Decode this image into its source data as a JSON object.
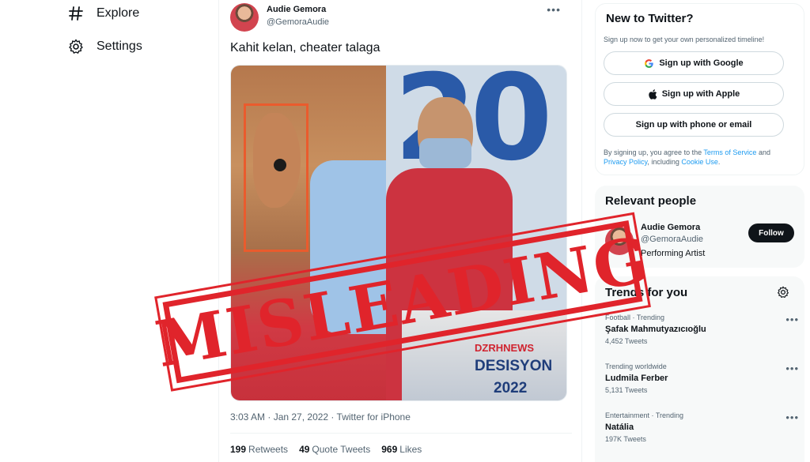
{
  "nav": {
    "items": [
      {
        "label": "Explore",
        "icon": "hashtag-icon"
      },
      {
        "label": "Settings",
        "icon": "gear-icon"
      }
    ]
  },
  "tweet": {
    "author_name": "Audie Gemora",
    "author_handle": "@GemoraAudie",
    "text": "Kahit kelan, cheater talaga",
    "media_text": {
      "station": "DZRHNEWS",
      "program": "DESISYON",
      "year": "2022"
    },
    "timestamp": "3:03 AM · Jan 27, 2022 · Twitter for iPhone",
    "stats": [
      {
        "value": "199",
        "label": "Retweets"
      },
      {
        "value": "49",
        "label": "Quote Tweets"
      },
      {
        "value": "969",
        "label": "Likes"
      }
    ]
  },
  "stamp": {
    "text": "MISLEADING",
    "color": "#e0242b"
  },
  "sidebar": {
    "new_to_twitter": {
      "title": "New to Twitter?",
      "subtitle": "Sign up now to get your own personalized timeline!",
      "google": "Sign up with Google",
      "apple": "Sign up with Apple",
      "phone": "Sign up with phone or email",
      "terms_pre": "By signing up, you agree to the ",
      "terms_link": "Terms of Service",
      "terms_mid": " and ",
      "privacy_link": "Privacy Policy",
      "terms_mid2": ", including ",
      "cookie_link": "Cookie Use",
      "terms_end": "."
    },
    "relevant": {
      "title": "Relevant people",
      "name": "Audie Gemora",
      "handle": "@GemoraAudie",
      "bio": "Performing Artist",
      "follow": "Follow"
    },
    "trends": {
      "title": "Trends for you",
      "items": [
        {
          "meta": "Football · Trending",
          "name": "Şafak Mahmutyazıcıoğlu",
          "count": "4,452 Tweets"
        },
        {
          "meta": "Trending worldwide",
          "name": "Ludmila Ferber",
          "count": "5,131 Tweets"
        },
        {
          "meta": "Entertainment · Trending",
          "name": "Natália",
          "count": "197K Tweets"
        }
      ]
    }
  },
  "colors": {
    "accent": "#1d9bf0",
    "text": "#0f1419",
    "muted": "#536471"
  }
}
